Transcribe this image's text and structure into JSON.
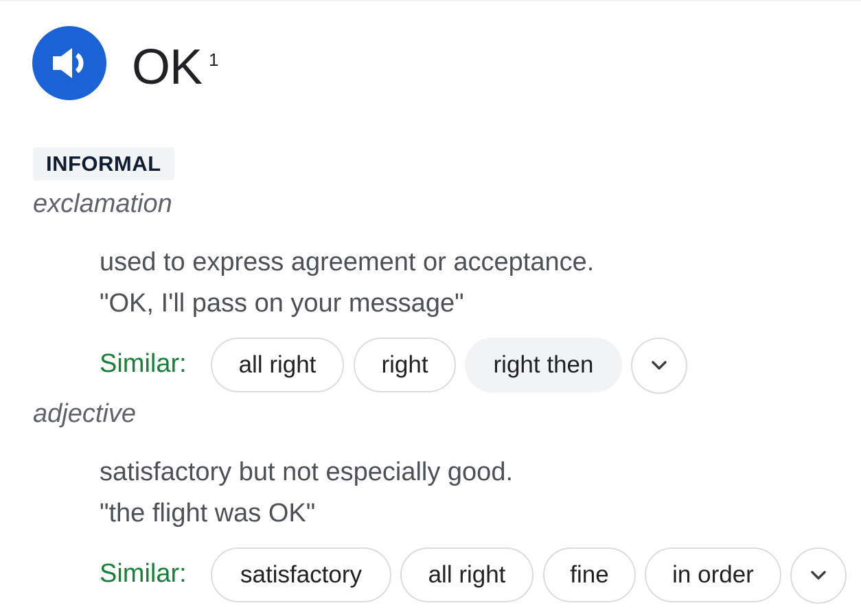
{
  "entry": {
    "headword": "OK",
    "homograph": "1",
    "pronounce_icon": "speaker-icon",
    "accent_color": "#1a62d6"
  },
  "register_label": "INFORMAL",
  "senses": [
    {
      "part_of_speech": "exclamation",
      "definition": "used to express agreement or acceptance.",
      "example": "\"OK, I'll pass on your message\"",
      "similar_label": "Similar:",
      "similar": [
        "all right",
        "right",
        "right then"
      ],
      "expand_icon": "chevron-down-icon"
    },
    {
      "part_of_speech": "adjective",
      "definition": "satisfactory but not especially good.",
      "example": "\"the flight was OK\"",
      "similar_label": "Similar:",
      "similar": [
        "satisfactory",
        "all right",
        "fine",
        "in order"
      ],
      "expand_icon": "chevron-down-icon"
    }
  ],
  "colors": {
    "similar_label": "#188038",
    "chip_border": "#dadce0",
    "chip_active_bg": "#f1f3f4"
  }
}
